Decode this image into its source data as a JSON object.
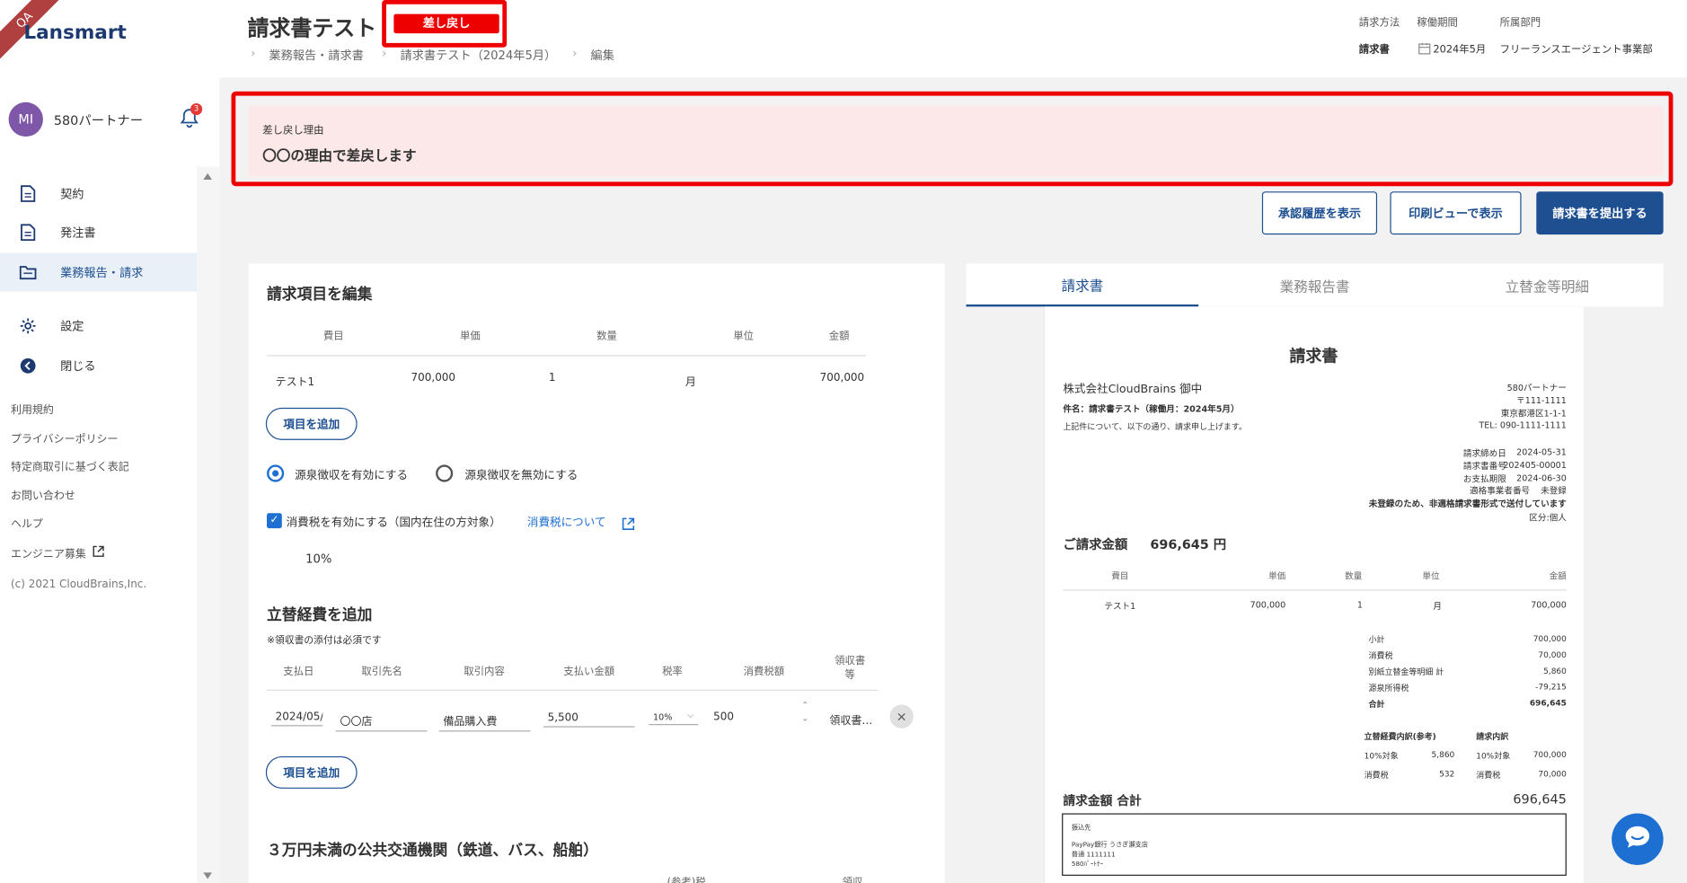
{
  "corner_badge": "QA",
  "brand": "Lansmart",
  "user": {
    "initials": "MI",
    "name": "580パートナー",
    "notifications": "3"
  },
  "nav": [
    {
      "label": "契約",
      "icon": "document-icon"
    },
    {
      "label": "発注書",
      "icon": "document-icon"
    },
    {
      "label": "業務報告・請求",
      "icon": "folder-icon",
      "active": true
    },
    {
      "label": "設定",
      "icon": "gear-icon"
    },
    {
      "label": "閉じる",
      "icon": "back-arrow-icon"
    }
  ],
  "footer_links": [
    "利用規約",
    "プライバシーポリシー",
    "特定商取引に基づく表記",
    "お問い合わせ",
    "ヘルプ",
    "エンジニア募集"
  ],
  "copyright": "(c) 2021 CloudBrains,Inc.",
  "header": {
    "title": "請求書テスト",
    "status": "差し戻し",
    "breadcrumb": [
      "業務報告・請求書",
      "請求書テスト（2024年5月）",
      "編集"
    ],
    "meta_labels": [
      "請求方法",
      "稼働期間",
      "所属部門"
    ],
    "meta_values": [
      "請求書",
      "2024年5月",
      "フリーランスエージェント事業部"
    ]
  },
  "reason": {
    "label": "差し戻し理由",
    "text": "〇〇の理由で差戻します"
  },
  "actions": {
    "history": "承認履歴を表示",
    "print": "印刷ビューで表示",
    "submit": "請求書を提出する"
  },
  "edit": {
    "title": "請求項目を編集",
    "columns": [
      "費目",
      "単価",
      "数量",
      "単位",
      "金額"
    ],
    "rows": [
      {
        "item": "テスト1",
        "price": "700,000",
        "qty": "1",
        "unit": "月",
        "amount": "700,000"
      }
    ],
    "add_item": "項目を追加",
    "withholding_on": "源泉徴収を有効にする",
    "withholding_off": "源泉徴収を無効にする",
    "tax_label": "消費税を有効にする（国内在住の方対象）",
    "tax_link": "消費税について",
    "tax_rate": "10%"
  },
  "expenses": {
    "title": "立替経費を追加",
    "note": "※領収書の添付は必須です",
    "columns": [
      "支払日",
      "取引先名",
      "取引内容",
      "支払い金額",
      "税率",
      "消費税額",
      "領収書等"
    ],
    "row": {
      "date": "2024/05/(",
      "vendor": "〇〇店",
      "content": "備品購入費",
      "amount": "5,500",
      "rate": "10%",
      "tax": "500",
      "receipt": "領収書…"
    },
    "add_item": "項目を追加"
  },
  "transport": {
    "title": "３万円未満の公共交通機関（鉄道、バス、船舶）",
    "col_a": "(参考)税",
    "col_b": "領収"
  },
  "tabs": [
    "請求書",
    "業務報告書",
    "立替金等明細"
  ],
  "invoice": {
    "title": "請求書",
    "client": "株式会社CloudBrains 御中",
    "subject": "件名：請求書テスト（稼働月：2024年5月）",
    "intro": "上記件について、以下の通り、請求申し上げます。",
    "issuer": [
      "580パートナー",
      "〒111-1111",
      "東京都港区1-1-1",
      "TEL: 090-1111-1111"
    ],
    "dates": [
      {
        "k": "請求締め日",
        "v": "2024-05-31"
      },
      {
        "k": "請求書番号",
        "v": "202405-00001"
      },
      {
        "k": "お支払期限",
        "v": "2024-06-30"
      },
      {
        "k": "適格事業者番号",
        "v": "未登録"
      }
    ],
    "notice": "未登録のため、非適格請求書形式で送付しています",
    "category": "区分:個人",
    "total_label": "ご請求金額",
    "total_value": "696,645 円",
    "columns": [
      "費目",
      "単価",
      "数量",
      "単位",
      "金額"
    ],
    "rows": [
      {
        "item": "テスト1",
        "price": "700,000",
        "qty": "1",
        "unit": "月",
        "amount": "700,000"
      }
    ],
    "summary": [
      {
        "k": "小計",
        "v": "700,000"
      },
      {
        "k": "消費税",
        "v": "70,000"
      },
      {
        "k": "別紙立替金等明細 計",
        "v": "5,860"
      },
      {
        "k": "源泉所得税",
        "v": "-79,215"
      },
      {
        "k": "合計",
        "v": "696,645"
      }
    ],
    "exp_breakdown": {
      "title": "立替経費内訳(参考)",
      "rows": [
        {
          "k": "10%対象",
          "v": "5,860"
        },
        {
          "k": "消費税",
          "v": "532"
        }
      ]
    },
    "inv_breakdown": {
      "title": "請求内訳",
      "rows": [
        {
          "k": "10%対象",
          "v": "700,000"
        },
        {
          "k": "消費税",
          "v": "70,000"
        }
      ]
    },
    "grand_label": "請求金額 合計",
    "grand_value": "696,645",
    "bank": [
      "振込先",
      "PayPay銀行 うさぎ瀬支店",
      "普通 1111111",
      "580ﾊﾟｰﾄﾅｰ"
    ]
  }
}
